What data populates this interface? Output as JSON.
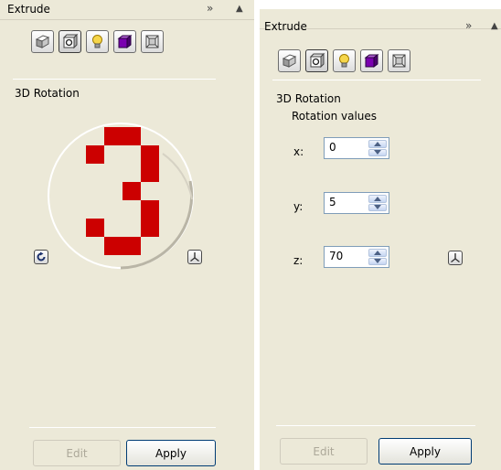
{
  "left_panel": {
    "title": "Extrude",
    "expand_glyph": "»",
    "collapse_glyph": "▲",
    "toolbar": [
      {
        "icon": "extrusion-shape-icon"
      },
      {
        "icon": "rotation-icon"
      },
      {
        "icon": "lighting-icon"
      },
      {
        "icon": "color-icon"
      },
      {
        "icon": "bevel-icon"
      }
    ],
    "section_title": "3D Rotation",
    "edit_label": "Edit",
    "apply_label": "Apply"
  },
  "right_panel": {
    "title": "Extrude",
    "expand_glyph": "»",
    "collapse_glyph": "▲",
    "section_title": "3D Rotation",
    "subtitle": "Rotation values",
    "x_label": "x:",
    "x_value": "0",
    "y_label": "y:",
    "y_value": "5",
    "z_label": "z:",
    "z_value": "70",
    "edit_label": "Edit",
    "apply_label": "Apply"
  },
  "colors": {
    "panel_bg": "#ece9d8",
    "glyph_red": "#cc0000"
  }
}
